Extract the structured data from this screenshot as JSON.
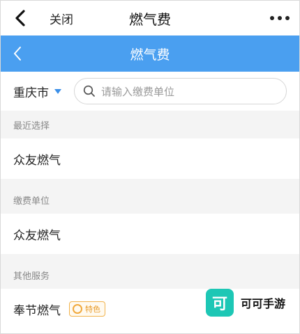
{
  "topbar": {
    "close_label": "关闭",
    "title": "燃气费"
  },
  "header": {
    "title": "燃气费"
  },
  "search": {
    "city": "重庆市",
    "placeholder": "请输入缴费单位"
  },
  "recent": {
    "heading": "最近选择",
    "items": [
      "众友燃气"
    ]
  },
  "units": {
    "heading": "缴费单位",
    "items": [
      "众友燃气"
    ]
  },
  "other": {
    "heading": "其他服务",
    "items": [
      {
        "label": "奉节燃气",
        "badge": "特色"
      }
    ]
  },
  "watermark": {
    "logo_char": "可",
    "text": "可可手游"
  },
  "colors": {
    "accent": "#4a9ff0",
    "badge": "#f1b24a",
    "watermark_logo": "#1dc7b5"
  }
}
